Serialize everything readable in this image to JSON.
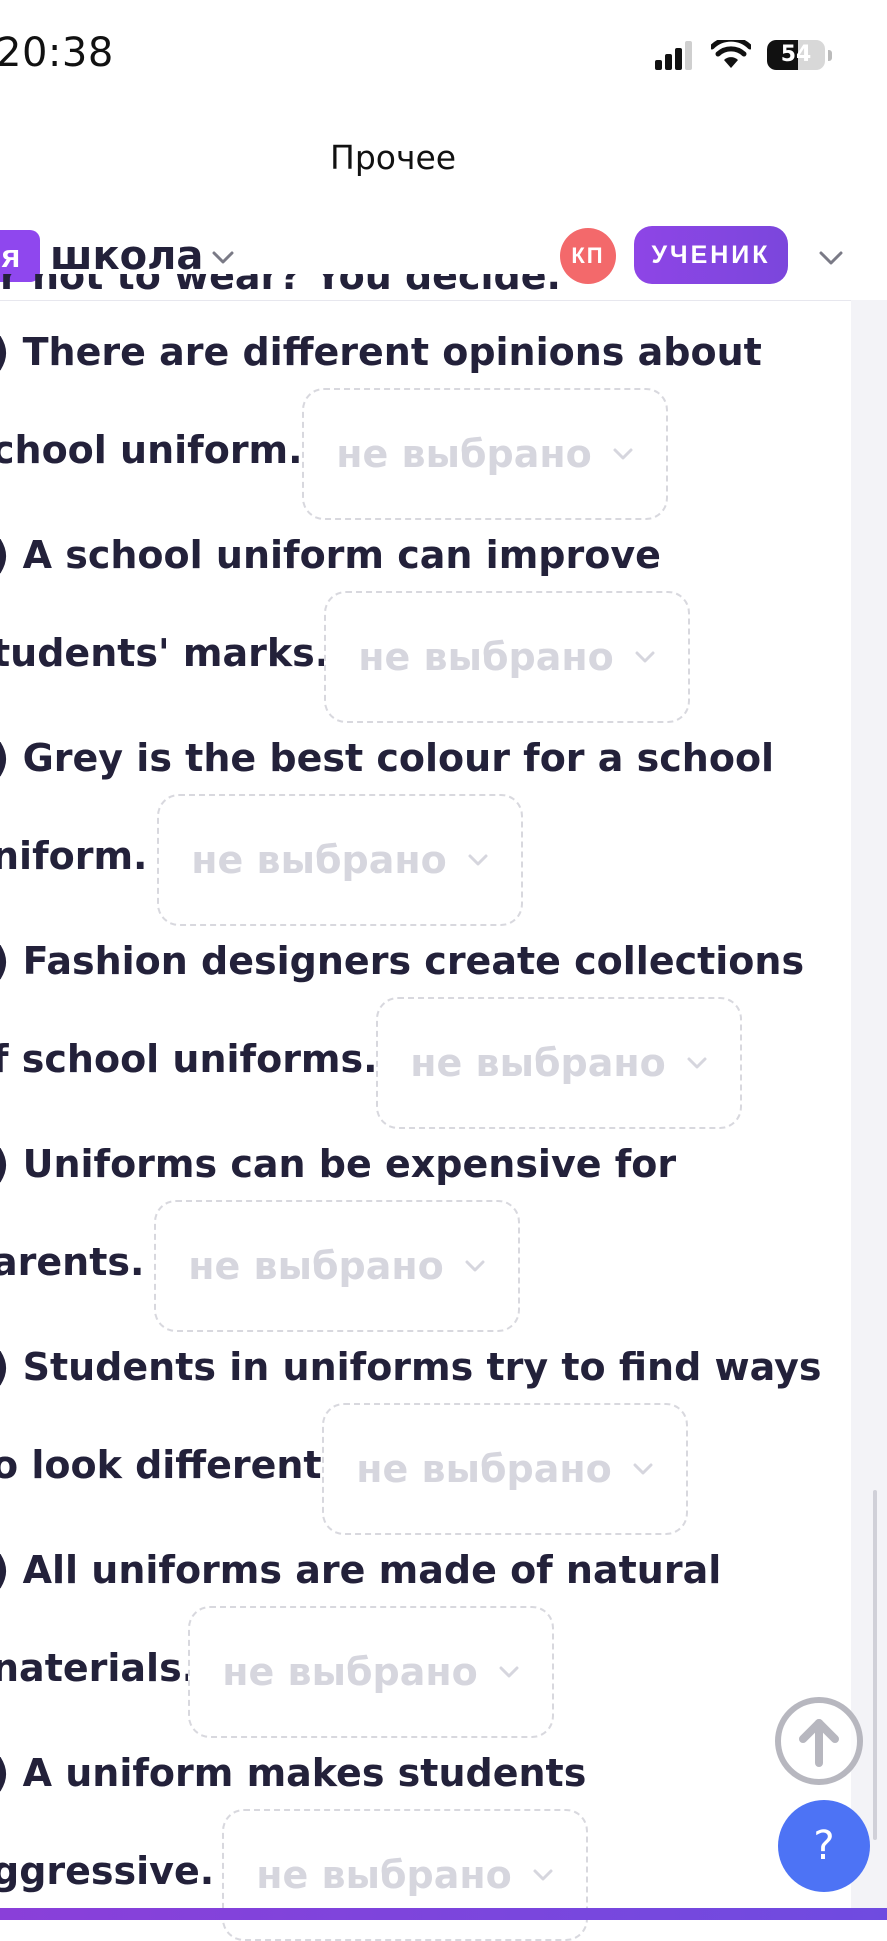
{
  "status_bar": {
    "time": "20:38",
    "battery": "54",
    "battery_level_percent": 54,
    "icons": [
      "cellular-signal-icon",
      "wifi-icon",
      "battery-icon"
    ]
  },
  "header": {
    "title": "Прочее"
  },
  "topbar": {
    "school_badge": "я",
    "school_name": "школа",
    "avatar_initials": "КП",
    "role": "УЧЕНИК"
  },
  "content": {
    "cutoff_text": "r not to wear? You decide.",
    "placeholder": "не выбрано",
    "questions": [
      {
        "line1": ") There are different opinions about",
        "line2": "chool uniform."
      },
      {
        "line1": ") A school uniform can improve",
        "line2": "tudents' marks."
      },
      {
        "line1": ") Grey is the best colour for a school",
        "line2": "niform."
      },
      {
        "line1": ") Fashion designers create collections",
        "line2": "f school uniforms."
      },
      {
        "line1": ") Uniforms can be expensive for",
        "line2": "arents."
      },
      {
        "line1": ") Students in uniforms try to find ways",
        "line2": "o look different."
      },
      {
        "line1": ") All uniforms are made of natural",
        "line2": "naterials."
      },
      {
        "line1": ") A uniform makes students",
        "line2": "ggressive."
      }
    ]
  },
  "help_button": {
    "label": "?"
  },
  "colors": {
    "accent_purple": "#8f47ee",
    "avatar_red": "#f3696b",
    "help_blue": "#4d73f5",
    "text_dark": "#23213a",
    "placeholder_grey": "#d6d6de"
  }
}
